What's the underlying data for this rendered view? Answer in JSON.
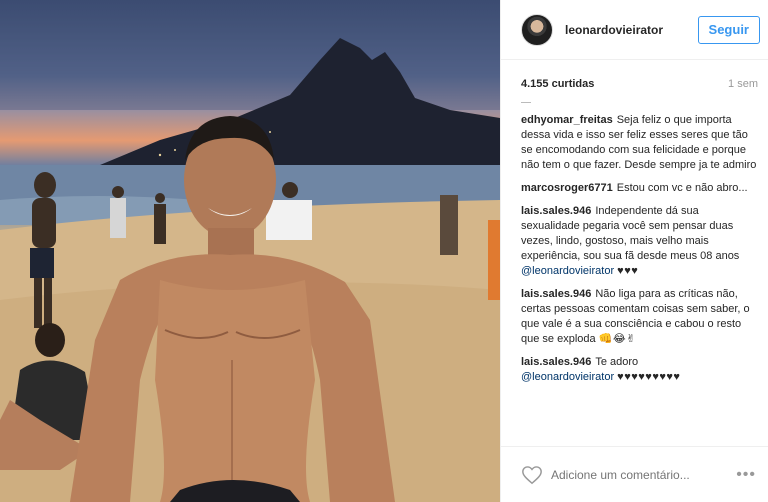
{
  "post": {
    "username": "leonardovieirator",
    "follow_label": "Seguir",
    "likes": "4.155 curtidas",
    "time": "1 sem"
  },
  "comments": [
    {
      "author": "edhyomar_freitas",
      "text": "Seja feliz o que importa dessa vida e isso ser feliz esses seres que tão se encomodando com sua felicidade e porque não tem o que fazer. Desde sempre ja te admiro"
    },
    {
      "author": "marcosroger6771",
      "text": "Estou com vc e não abro..."
    },
    {
      "author": "lais.sales.946",
      "text": "Independente dá sua sexualidade pegaria você sem pensar duas vezes, lindo, gostoso, mais velho mais experiência, sou sua fã desde meus 08 anos",
      "mention": "@leonardovieirator",
      "emoji": "♥♥♥"
    },
    {
      "author": "lais.sales.946",
      "text": "Não liga para as críticas não, certas pessoas comentam coisas sem saber, o que vale é a sua consciência e cabou o resto que se exploda",
      "emoji": "👊😂✌"
    },
    {
      "author": "lais.sales.946",
      "text": "Te adoro",
      "mention": "@leonardovieirator",
      "emoji": "♥♥♥♥♥♥♥♥♥"
    }
  ],
  "footer": {
    "comment_placeholder": "Adicione um comentário...",
    "more_glyph": "•••"
  },
  "icons": {
    "heart": "heart-outline-icon",
    "more": "ellipsis-icon"
  }
}
